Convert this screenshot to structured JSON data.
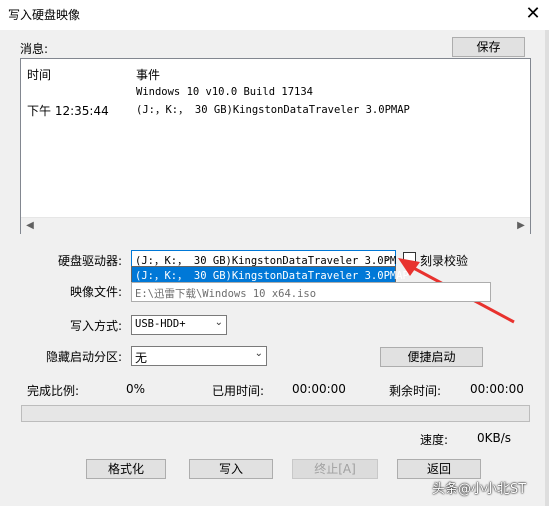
{
  "window": {
    "title": "写入硬盘映像",
    "close_glyph": "✕"
  },
  "messages": {
    "label": "消息:",
    "save_label": "保存",
    "columns": [
      "时间",
      "事件"
    ],
    "rows": [
      {
        "time": "",
        "event": "Windows 10 v10.0 Build 17134"
      },
      {
        "time": "下午 12:35:44",
        "event": "(J:，K:， 30 GB)KingstonDataTraveler 3.0PMAP"
      }
    ]
  },
  "drive": {
    "label": "硬盘驱动器:",
    "selected": "(J:，K:， 30 GB)KingstonDataTraveler 3.0PM",
    "option_highlighted": "(J:，K:， 30 GB)KingstonDataTraveler 3.0PMAP",
    "verify_label": "刻录校验"
  },
  "image_file": {
    "label": "映像文件:",
    "value": "E:\\迅雷下载\\Windows 10 x64.iso"
  },
  "write_mode": {
    "label": "写入方式:",
    "value": "USB-HDD+"
  },
  "hidden_partition": {
    "label": "隐藏启动分区:",
    "value": "无"
  },
  "quick_boot_label": "便捷启动",
  "status": {
    "done_label": "完成比例:",
    "done_value": "0%",
    "elapsed_label": "已用时间:",
    "elapsed_value": "00:00:00",
    "remaining_label": "剩余时间:",
    "remaining_value": "00:00:00",
    "progress_fraction": 0,
    "speed_label": "速度:",
    "speed_value": "0KB/s"
  },
  "buttons": {
    "format": "格式化",
    "write": "写入",
    "stop": "终止[A]",
    "back": "返回"
  },
  "watermark": "头条@小小北ST"
}
